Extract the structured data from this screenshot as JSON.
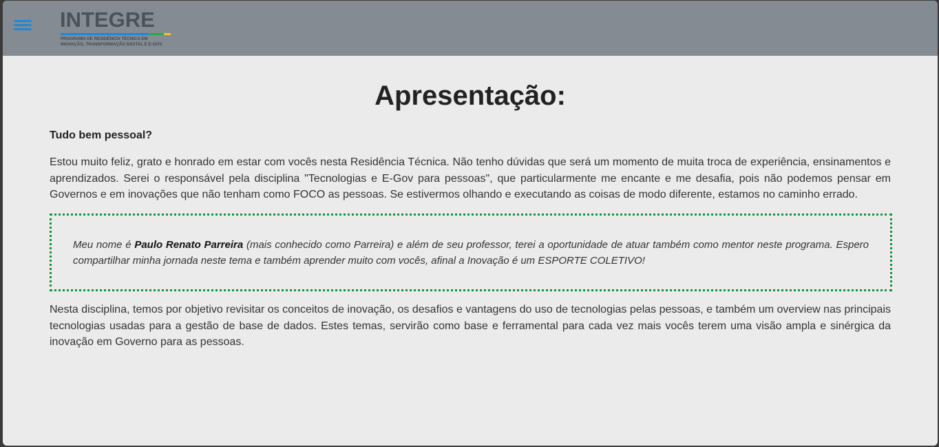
{
  "header": {
    "logo_title": "INTEGRE",
    "logo_subtitle_line1": "PROGRAMA DE RESIDÊNCIA TÉCNICA EM",
    "logo_subtitle_line2": "INOVAÇÃO, TRANSFORMAÇÃO DIGITAL E E-GOV",
    "menu_icon": "hamburger-menu-icon"
  },
  "colors": {
    "header_bg": "#858b92",
    "page_bg": "#ebebeb",
    "menu_icon": "#1e88d8",
    "quote_border": "#12923a",
    "logo_stripe": [
      "#1e88d8",
      "#2aa84a",
      "#f2c230"
    ]
  },
  "main": {
    "title": "Apresentação:",
    "greeting": "Tudo bem pessoal?",
    "paragraph1": "Estou muito feliz, grato e honrado em estar com vocês nesta Residência Técnica. Não tenho dúvidas que será um momento de muita troca de experiência, ensinamentos e aprendizados. Serei o responsável pela disciplina \"Tecnologias e E-Gov para pessoas\", que particularmente me encante e me desafia, pois não podemos pensar em Governos e em inovações que não tenham como FOCO as pessoas. Se estivermos olhando e executando as coisas de modo diferente, estamos no caminho errado.",
    "quote": {
      "before_name": "Meu nome é ",
      "name": "Paulo Renato Parreira",
      "after_name": " (mais conhecido como Parreira) e além de seu professor, terei a oportunidade de atuar também como mentor neste programa. Espero compartilhar minha jornada neste tema e também aprender muito com vocês, afinal a Inovação é um ESPORTE COLETIVO!"
    },
    "paragraph2": "Nesta disciplina, temos por objetivo revisitar os conceitos de inovação, os desafios e vantagens do uso de tecnologias pelas pessoas, e também um overview nas principais tecnologias usadas para a gestão de base de dados. Estes temas, servirão como base e ferramental para cada vez mais vocês terem uma visão ampla e sinérgica da inovação em Governo para as pessoas."
  }
}
